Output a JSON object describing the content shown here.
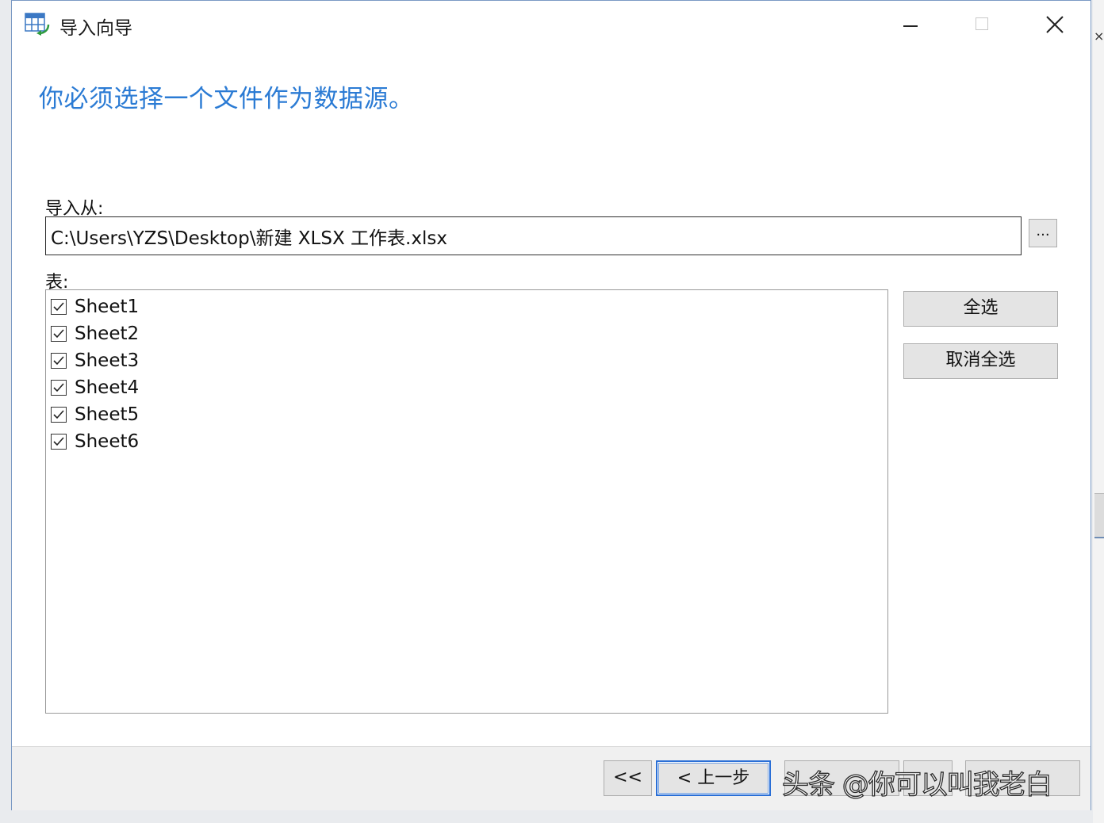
{
  "window": {
    "title": "导入向导"
  },
  "heading": "你必须选择一个文件作为数据源。",
  "import_from": {
    "label": "导入从:",
    "path": "C:\\Users\\YZS\\Desktop\\新建 XLSX 工作表.xlsx",
    "browse_label": "..."
  },
  "tables": {
    "label": "表:",
    "sheets": [
      {
        "name": "Sheet1",
        "checked": true
      },
      {
        "name": "Sheet2",
        "checked": true
      },
      {
        "name": "Sheet3",
        "checked": true
      },
      {
        "name": "Sheet4",
        "checked": true
      },
      {
        "name": "Sheet5",
        "checked": true
      },
      {
        "name": "Sheet6",
        "checked": true
      }
    ],
    "select_all_label": "全选",
    "deselect_all_label": "取消全选"
  },
  "footer": {
    "first_label": "<<",
    "prev_label": "< 上一步"
  },
  "watermark": "头条 @你可以叫我老白",
  "colors": {
    "heading": "#2b7bd4",
    "focus_border": "#2a6fd6"
  }
}
